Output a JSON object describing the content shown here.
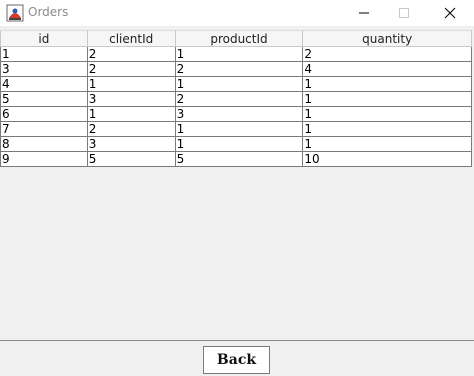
{
  "window": {
    "title": "Orders",
    "minimize_icon": "minimize-icon",
    "maximize_icon": "maximize-icon",
    "close_icon": "close-icon"
  },
  "table": {
    "columns": [
      "id",
      "clientId",
      "productId",
      "quantity"
    ],
    "rows": [
      [
        "1",
        "2",
        "1",
        "2"
      ],
      [
        "3",
        "2",
        "2",
        "4"
      ],
      [
        "4",
        "1",
        "1",
        "1"
      ],
      [
        "5",
        "3",
        "2",
        "1"
      ],
      [
        "6",
        "1",
        "3",
        "1"
      ],
      [
        "7",
        "2",
        "1",
        "1"
      ],
      [
        "8",
        "3",
        "1",
        "1"
      ],
      [
        "9",
        "5",
        "5",
        "10"
      ]
    ]
  },
  "footer": {
    "back_label": "Back"
  }
}
